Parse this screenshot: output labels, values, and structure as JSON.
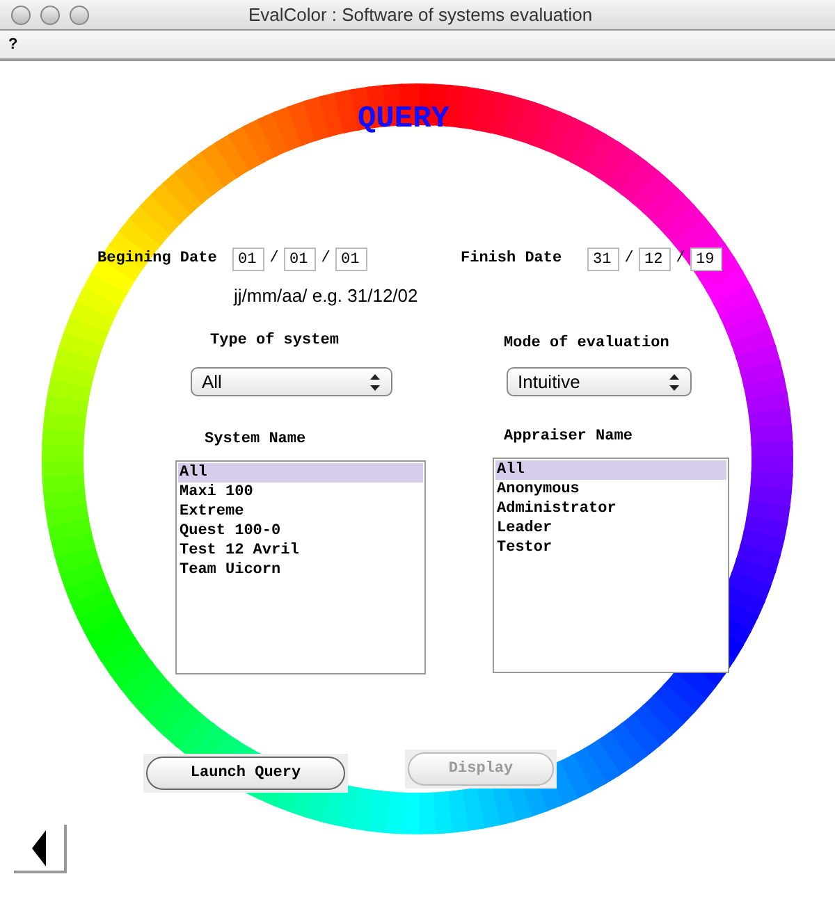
{
  "window": {
    "title": "EvalColor : Software of systems evaluation"
  },
  "menu": [
    "?"
  ],
  "heading": "QUERY",
  "begin_date": {
    "label": "Begining Date",
    "fields": [
      "01",
      "01",
      "01"
    ],
    "separators": [
      "/",
      "/"
    ]
  },
  "finish_date": {
    "label": "Finish Date",
    "fields": [
      "31",
      "12",
      "19"
    ],
    "separators": [
      "/",
      "/"
    ]
  },
  "date_hint": "jj/mm/aa/ e.g. 31/12/02",
  "type_of_system": {
    "label": "Type of system",
    "value": "All"
  },
  "mode_of_evaluation": {
    "label": "Mode of evaluation",
    "value": "Intuitive"
  },
  "system_names": {
    "label": "System Name",
    "items": [
      {
        "text": "All",
        "selected": true
      },
      {
        "text": "Maxi 100",
        "selected": false
      },
      {
        "text": "Extreme",
        "selected": false
      },
      {
        "text": "Quest 100-0",
        "selected": false
      },
      {
        "text": "Test 12 Avril",
        "selected": false
      },
      {
        "text": "Team Uicorn",
        "selected": false
      }
    ]
  },
  "appraiser_names": {
    "label": "Appraiser Name",
    "items": [
      {
        "text": "All",
        "selected": true
      },
      {
        "text": "Anonymous",
        "selected": false
      },
      {
        "text": "Administrator",
        "selected": false
      },
      {
        "text": "Leader",
        "selected": false
      },
      {
        "text": "Testor",
        "selected": false
      }
    ]
  },
  "buttons": [
    {
      "label": "Launch Query",
      "disabled": false
    },
    {
      "label": "Display",
      "disabled": true
    }
  ]
}
